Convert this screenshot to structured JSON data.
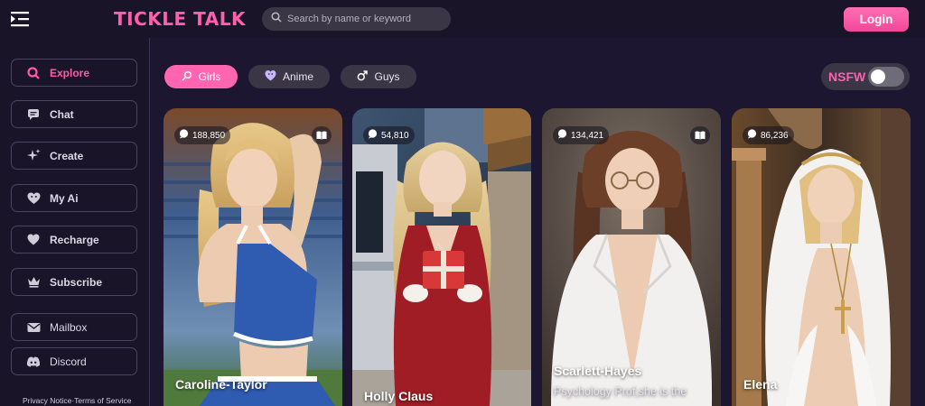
{
  "header": {
    "logo": "TICKLE TALK",
    "search_placeholder": "Search by name or keyword",
    "login_label": "Login"
  },
  "sidebar": {
    "items": [
      {
        "label": "Explore",
        "icon": "search-icon"
      },
      {
        "label": "Chat",
        "icon": "chat-icon"
      },
      {
        "label": "Create",
        "icon": "sparkle-icon"
      },
      {
        "label": "My Ai",
        "icon": "heart-face-icon"
      },
      {
        "label": "Recharge",
        "icon": "heart-icon"
      },
      {
        "label": "Subscribe",
        "icon": "crown-icon"
      },
      {
        "label": "Mailbox",
        "icon": "mail-icon"
      },
      {
        "label": "Discord",
        "icon": "discord-icon"
      }
    ],
    "privacy_label": "Privacy Notice",
    "separator": "·",
    "terms_label": "Terms of Service"
  },
  "filters": [
    {
      "label": "Girls",
      "icon": "female-icon",
      "active": true
    },
    {
      "label": "Anime",
      "icon": "anime-icon",
      "active": false
    },
    {
      "label": "Guys",
      "icon": "male-icon",
      "active": false
    }
  ],
  "nsfw": {
    "label": "NSFW",
    "enabled": false
  },
  "cards": [
    {
      "name": "Caroline-Taylor",
      "count": "188,850",
      "has_book": true,
      "description": ""
    },
    {
      "name": "Holly Claus",
      "count": "54,810",
      "has_book": false,
      "description": ""
    },
    {
      "name": "Scarlett-Hayes",
      "count": "134,421",
      "has_book": true,
      "description": "Psychology Prof,she is the"
    },
    {
      "name": "Elena",
      "count": "86,236",
      "has_book": false,
      "description": ""
    }
  ],
  "colors": {
    "accent": "#ff5fae",
    "background": "#1c1630",
    "panel": "#1a1428",
    "pill": "#3a3646"
  }
}
